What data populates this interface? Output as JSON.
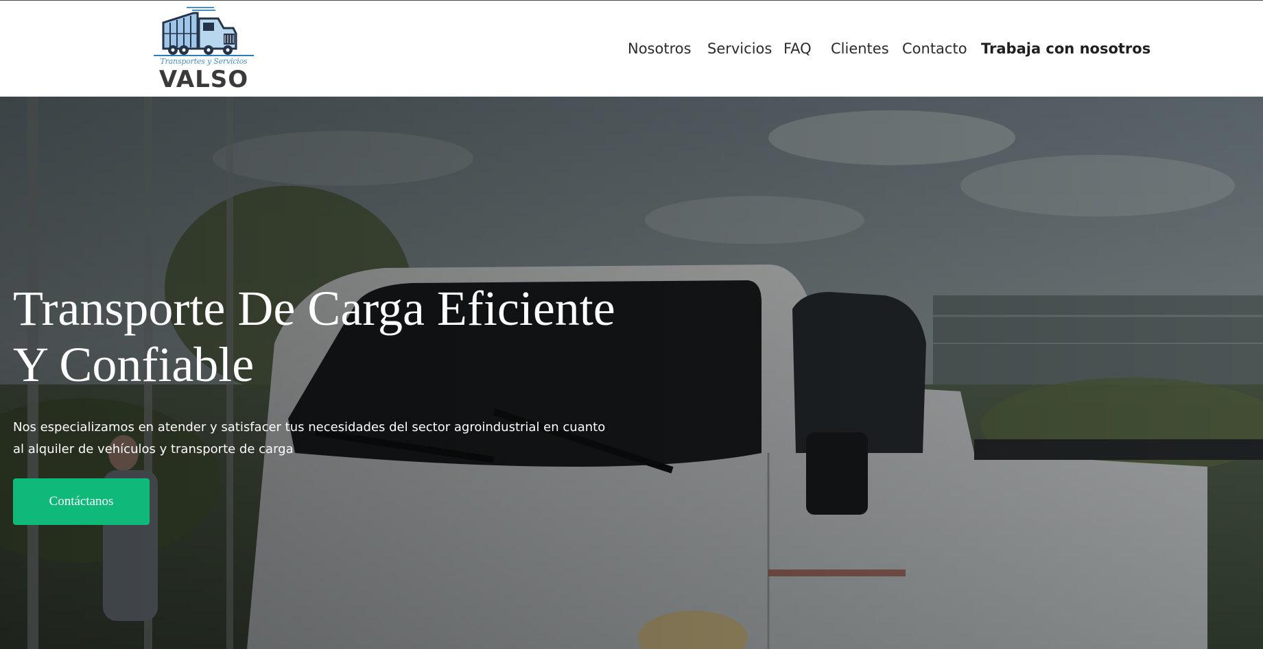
{
  "logo": {
    "tagline": "Transportes y Servicios",
    "name": "VALSO"
  },
  "nav": {
    "items": [
      {
        "label": "Nosotros"
      },
      {
        "label": "Servicios"
      },
      {
        "label": "FAQ"
      },
      {
        "label": "Clientes"
      },
      {
        "label": "Contacto"
      },
      {
        "label": "Trabaja con nosotros"
      }
    ]
  },
  "hero": {
    "title_line1": "Transporte De Carga Eficiente",
    "title_line2": "Y Confiable",
    "description": "Nos especializamos en atender y satisfacer tus necesidades del sector agroindustrial en cuanto al alquiler de vehículos y transporte de carga",
    "cta_label": "Contáctanos"
  },
  "colors": {
    "accent": "#0fb97a",
    "nav_text": "#2b2b2b",
    "logo_blue": "#4b8ec4",
    "logo_dark": "#3a3a3a"
  }
}
